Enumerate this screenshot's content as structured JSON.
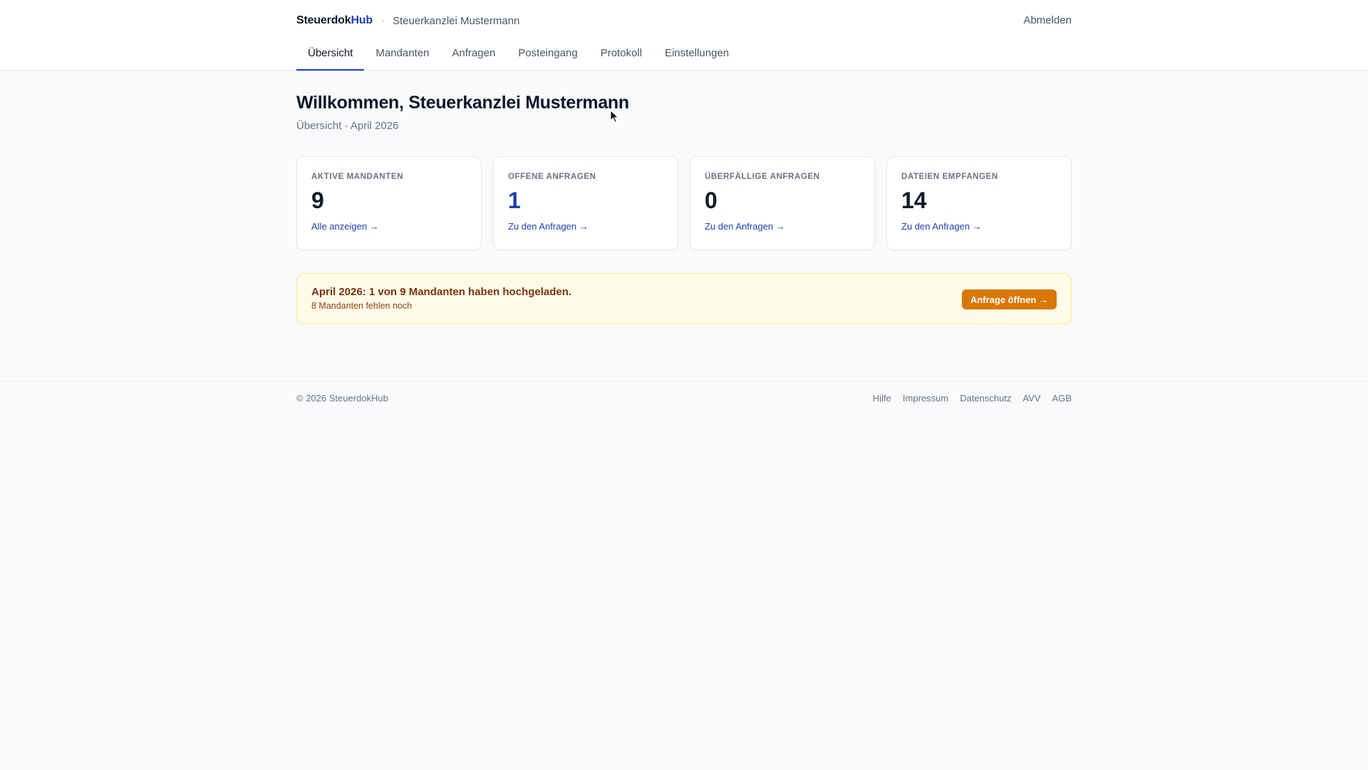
{
  "header": {
    "logo_main": "Steuerdok",
    "logo_accent": "Hub",
    "firm_name": "Steuerkanzlei Mustermann",
    "logout_label": "Abmelden"
  },
  "nav": {
    "items": [
      {
        "label": "Übersicht",
        "active": true
      },
      {
        "label": "Mandanten",
        "active": false
      },
      {
        "label": "Anfragen",
        "active": false
      },
      {
        "label": "Posteingang",
        "active": false
      },
      {
        "label": "Protokoll",
        "active": false
      },
      {
        "label": "Einstellungen",
        "active": false
      }
    ]
  },
  "main": {
    "welcome": "Willkommen, Steuerkanzlei Mustermann",
    "subtitle": "Übersicht · April 2026",
    "cards": [
      {
        "label": "AKTIVE MANDANTEN",
        "value": "9",
        "link": "Alle anzeigen →"
      },
      {
        "label": "OFFENE ANFRAGEN",
        "value": "1",
        "link": "Zu den Anfragen →"
      },
      {
        "label": "ÜBERFÄLLIGE ANFRAGEN",
        "value": "0",
        "link": "Zu den Anfragen →"
      },
      {
        "label": "DATEIEN EMPFANGEN",
        "value": "14",
        "link": "Zu den Anfragen →"
      }
    ],
    "notice": {
      "title": "April 2026: 1 von 9 Mandanten haben hochgeladen.",
      "subtitle": "8 Mandanten fehlen noch",
      "button": "Anfrage öffnen →"
    }
  },
  "footer": {
    "copyright": "© 2026 SteuerdokHub",
    "links": [
      "Hilfe",
      "Impressum",
      "Datenschutz",
      "AVV",
      "AGB"
    ]
  },
  "colors": {
    "accent": "#1e40af",
    "notice_bg": "#fefce8",
    "notice_button": "#d97706"
  },
  "icons": {
    "cursor": "mouse-pointer-icon"
  }
}
